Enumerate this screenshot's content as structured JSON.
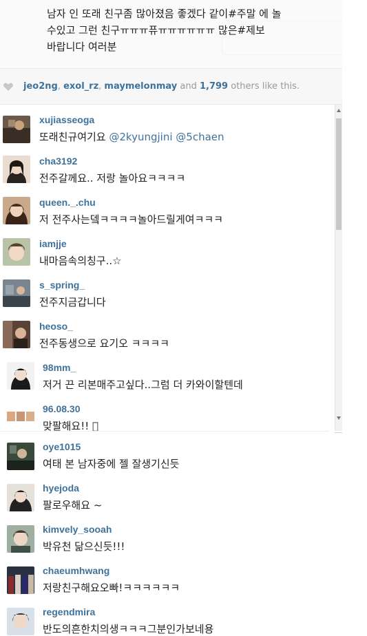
{
  "caption": {
    "line1": "남자 인 또래 친구좀 많아졌음 좋겠다 같이#주말 에 놀",
    "line2": "수있고 그런 친구ㅠㅠㅠ퓨ㅠㅠㅠㅠㅠㅠ 많은#제보",
    "line3": "바랍니다 여러분"
  },
  "likes": {
    "user1": "jeo2ng",
    "user2": "exol_rz",
    "user3": "maymelonmay",
    "and_text": "and",
    "count": "1,799",
    "suffix": "others like this."
  },
  "comments": [
    {
      "user": "xujiasseoga",
      "text": "또래친규여기요",
      "mentions": "@2kyungjini @5chaen"
    },
    {
      "user": "cha3192",
      "text": "전주갈께요.. 저랑 놀아요ㅋㅋㅋㅋ"
    },
    {
      "user": "queen._.chu",
      "text": "저 전주사는뎈ㅋㅋㅋㅋ놀아드릴게여ㅋㅋㅋ"
    },
    {
      "user": "iamjje",
      "text": "내마음속의칭구..☆"
    },
    {
      "user": "s_spring_",
      "text": "전주지금갑니다"
    },
    {
      "user": "heoso_",
      "text": "전주동생으로 요기오 ㅋㅋㅋㅋ"
    },
    {
      "user": "98mm_",
      "text": "저거 끈 리본매주고싶다..그럼 더 카와이할텐데"
    },
    {
      "user": "96.08.30",
      "text": "맞팔해요!! 󾌵"
    },
    {
      "user": "oye1015",
      "text": "여태 본 남자중에 젤 잘생기신듯"
    },
    {
      "user": "hyejoda",
      "text": "팔로우해요 ~"
    },
    {
      "user": "kimvely_sooah",
      "text": "박유천 닮으신듯!!!"
    },
    {
      "user": "chaeumhwang",
      "text": "저랑친구해요오빠!ㅋㅋㅋㅋㅋㅋ"
    },
    {
      "user": "regendmira",
      "text": "반도의흔한치의생ㅋㅋㅋ그분인가보네용"
    }
  ]
}
